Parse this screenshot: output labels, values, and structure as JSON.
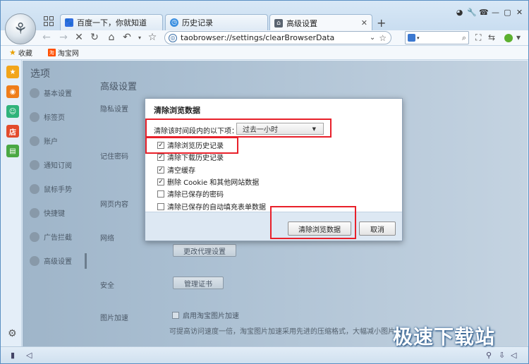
{
  "tabs": [
    {
      "label": "百度一下，你就知道",
      "icon": "baidu-icon"
    },
    {
      "label": "历史记录",
      "icon": "history-icon"
    },
    {
      "label": "高级设置",
      "icon": "settings-icon"
    }
  ],
  "address": {
    "url": "taobrowser://settings/clearBrowserData"
  },
  "bookmarks": [
    {
      "label": "收藏",
      "icon": "star-icon"
    },
    {
      "label": "淘宝网",
      "icon": "taobao-icon"
    }
  ],
  "settings_nav": {
    "header": "选项",
    "items": [
      "基本设置",
      "标签页",
      "账户",
      "通知订阅",
      "鼠标手势",
      "快捷键",
      "广告拦截",
      "高级设置"
    ]
  },
  "main": {
    "title": "高级设置",
    "sections": [
      "隐私设置",
      "记住密码",
      "网页内容",
      "网络",
      "安全",
      "图片加速"
    ],
    "proxy_button": "更改代理设置",
    "cert_button": "管理证书",
    "image_accel_checkbox": "启用淘宝图片加速",
    "image_accel_desc": "可提高访问速度一倍，淘宝图片加速采用先进的压缩格式，大幅减小图片文"
  },
  "dialog": {
    "title": "清除浏览数据",
    "range_label": "清除该时间段内的以下项：",
    "range_value": "过去一小时",
    "options": [
      {
        "label": "清除浏览历史记录",
        "checked": true
      },
      {
        "label": "清除下载历史记录",
        "checked": true
      },
      {
        "label": "清空缓存",
        "checked": true
      },
      {
        "label": "删除 Cookie 和其他网站数据",
        "checked": true
      },
      {
        "label": "清除已保存的密码",
        "checked": false
      },
      {
        "label": "清除已保存的自动填充表单数据",
        "checked": false
      }
    ],
    "confirm_button": "清除浏览数据",
    "cancel_button": "取消"
  },
  "watermark": "极速下载站",
  "colors": {
    "highlight": "#e8202a",
    "accent": "#3e8bd4"
  }
}
